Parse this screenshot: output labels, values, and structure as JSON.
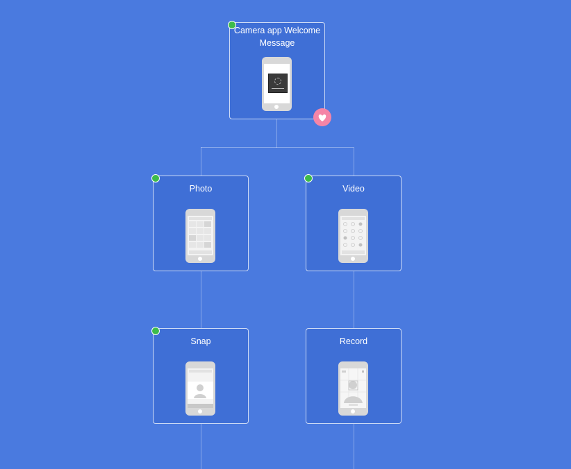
{
  "colors": {
    "background": "#4a7adf",
    "card": "#3f6fd6",
    "status_dot": "#3dbb4a",
    "heart_badge": "#f585a7"
  },
  "nodes": [
    {
      "id": "welcome",
      "title": "Camera app Welcome Message",
      "status_dot": true,
      "favorite": true,
      "screen": "loading-screen"
    },
    {
      "id": "photo",
      "title": "Photo",
      "status_dot": true,
      "favorite": false,
      "screen": "photo-grid-screen"
    },
    {
      "id": "video",
      "title": "Video",
      "status_dot": true,
      "favorite": false,
      "screen": "video-grid-screen"
    },
    {
      "id": "snap",
      "title": "Snap",
      "status_dot": true,
      "favorite": false,
      "screen": "snap-camera-screen"
    },
    {
      "id": "record",
      "title": "Record",
      "status_dot": false,
      "favorite": false,
      "screen": "record-camera-screen"
    }
  ],
  "edges": [
    {
      "from": "welcome",
      "to": "photo"
    },
    {
      "from": "welcome",
      "to": "video"
    },
    {
      "from": "photo",
      "to": "snap"
    },
    {
      "from": "video",
      "to": "record"
    }
  ],
  "icons": {
    "favorite": "heart-icon",
    "status": "status-dot-icon"
  }
}
